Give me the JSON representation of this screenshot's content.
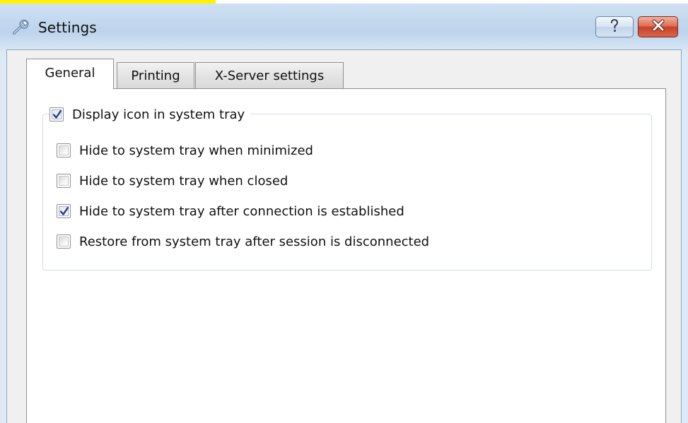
{
  "window": {
    "title": "Settings",
    "title_icon": "wrench-icon",
    "help_button": {
      "icon": "question-mark-icon"
    },
    "close_button": {
      "icon": "close-x-icon"
    }
  },
  "tabs": [
    {
      "label": "General",
      "active": true
    },
    {
      "label": "Printing",
      "active": false
    },
    {
      "label": "X-Server settings",
      "active": false
    }
  ],
  "general": {
    "group": {
      "label": "Display icon in system tray",
      "checked": true
    },
    "options": [
      {
        "label": "Hide to system tray when minimized",
        "checked": false
      },
      {
        "label": "Hide to system tray when closed",
        "checked": false
      },
      {
        "label": "Hide to system tray after connection is established",
        "checked": true
      },
      {
        "label": "Restore from system tray after session is disconnected",
        "checked": false
      }
    ]
  },
  "colors": {
    "highlight": "#fff200",
    "close_button": "#c8412a",
    "checkmark": "#1f3a93"
  }
}
